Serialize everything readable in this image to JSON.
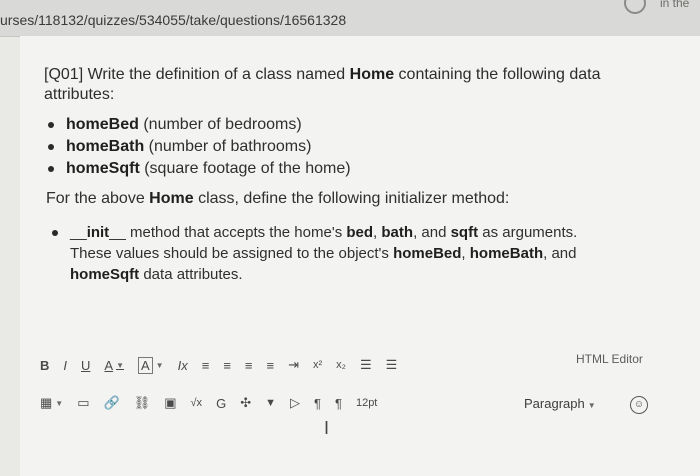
{
  "browser": {
    "url": "urses/118132/quizzes/534055/take/questions/16561328",
    "corner_text": "in the"
  },
  "question": {
    "prefix": "[Q01] Write the definition of a class named ",
    "class_name": "Home",
    "suffix": " containing the following data",
    "line2": "attributes:",
    "attributes": [
      {
        "name": "homeBed",
        "desc": " (number of bedrooms)"
      },
      {
        "name": "homeBath",
        "desc": " (number of bathrooms)"
      },
      {
        "name": "homeSqft",
        "desc": " (square footage of the home)"
      }
    ],
    "subhead_pre": "For the above ",
    "subhead_class": "Home",
    "subhead_post": " class, define the following initializer method:",
    "init_lead": "__",
    "init_name": "init",
    "init_tail": "__ method that accepts the home's ",
    "arg_bed": "bed",
    "sep1": ", ",
    "arg_bath": "bath",
    "sep2": ", and ",
    "arg_sqft": "sqft",
    "init_tail2": " as arguments.",
    "line3_pre": "These values should be assigned to the object's ",
    "attr1": "homeBed",
    "line3_sep1": ", ",
    "attr2": "homeBath",
    "line3_sep2": ", and",
    "attr3": "homeSqft",
    "line4_post": " data attributes."
  },
  "editor": {
    "bold": "B",
    "italic": "I",
    "underline": "U",
    "font_color": "A",
    "bg_color": "A",
    "clear_format": "Ix",
    "align_left": "≡",
    "align_center": "≡",
    "align_right": "≡",
    "align_justify": "≡",
    "indent": "⇥",
    "superscript": "x²",
    "subscript": "x₂",
    "bullet_list": "☰",
    "numbered_list": "☰",
    "html_editor": "HTML Editor",
    "table": "▦",
    "media": "▭",
    "link": "🔗",
    "unlink": "⛓",
    "image": "▣",
    "math": "√x",
    "plugin": "G",
    "embed": "✣",
    "dropdown": "▼",
    "video": "▷",
    "ltr": "¶",
    "rtl": "¶",
    "font_size": "12pt",
    "paragraph": "Paragraph",
    "accessibility": "☺",
    "text_cursor": "I"
  }
}
